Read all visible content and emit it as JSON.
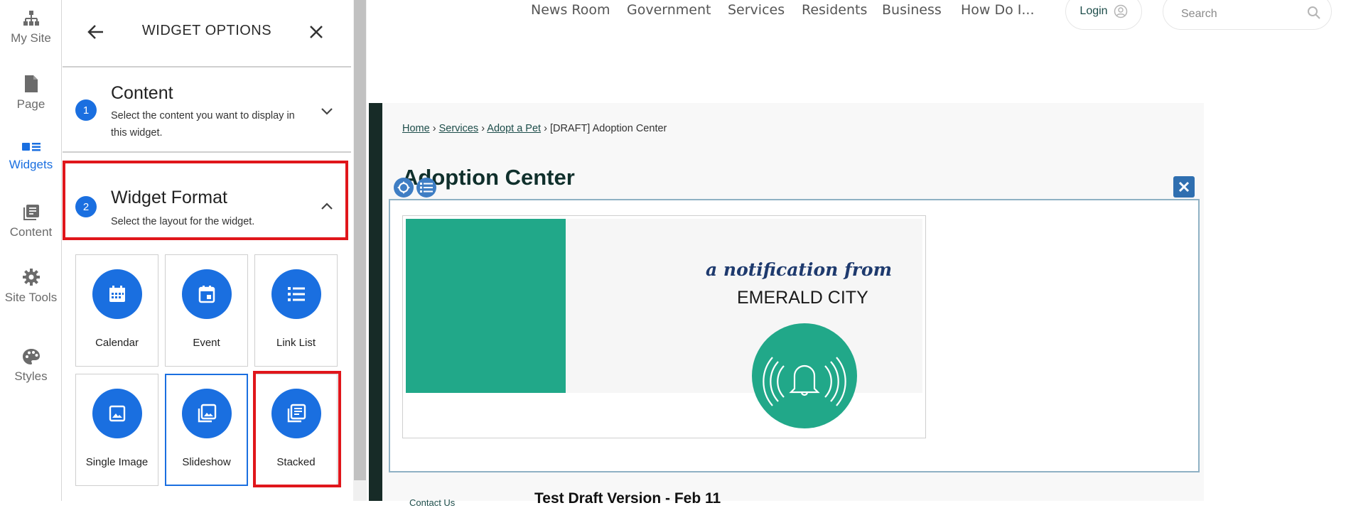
{
  "rail": {
    "items": [
      {
        "label": "My Site",
        "icon": "sitemap-icon"
      },
      {
        "label": "Page",
        "icon": "page-icon"
      },
      {
        "label": "Widgets",
        "icon": "widgets-icon",
        "active": true
      },
      {
        "label": "Content",
        "icon": "content-icon"
      },
      {
        "label": "Site Tools",
        "icon": "gear-icon"
      },
      {
        "label": "Styles",
        "icon": "palette-icon"
      }
    ]
  },
  "panel": {
    "title": "WIDGET OPTIONS",
    "sections": [
      {
        "step": "1",
        "title": "Content",
        "description": "Select the content you want to display in this widget.",
        "expanded": false
      },
      {
        "step": "2",
        "title": "Widget Format",
        "description": "Select the layout for the widget.",
        "expanded": true
      }
    ],
    "formats": [
      {
        "label": "Calendar",
        "icon": "calendar-icon"
      },
      {
        "label": "Event",
        "icon": "event-icon"
      },
      {
        "label": "Link List",
        "icon": "list-icon"
      },
      {
        "label": "Single Image",
        "icon": "image-icon"
      },
      {
        "label": "Slideshow",
        "icon": "slideshow-icon",
        "selected": true
      },
      {
        "label": "Stacked",
        "icon": "stacked-icon"
      }
    ]
  },
  "site": {
    "nav": [
      "News Room",
      "Government",
      "Services",
      "Residents",
      "Business",
      "How Do I..."
    ],
    "login_label": "Login",
    "search_placeholder": "Search",
    "breadcrumb": {
      "home": "Home",
      "services": " Services",
      "adopt": " Adopt a Pet",
      "current": "[DRAFT] Adoption Center"
    },
    "page_title": "Adoption Center",
    "image": {
      "tagline": "a notification from",
      "city": "EMERALD CITY"
    },
    "bottom_heading": "Test Draft Version - Feb 11",
    "bottom_link": "Contact Us"
  },
  "colors": {
    "accent": "#1a6fe0",
    "highlight": "#e0161b",
    "brand_green": "#21a889",
    "brand_dark": "#172b27"
  }
}
